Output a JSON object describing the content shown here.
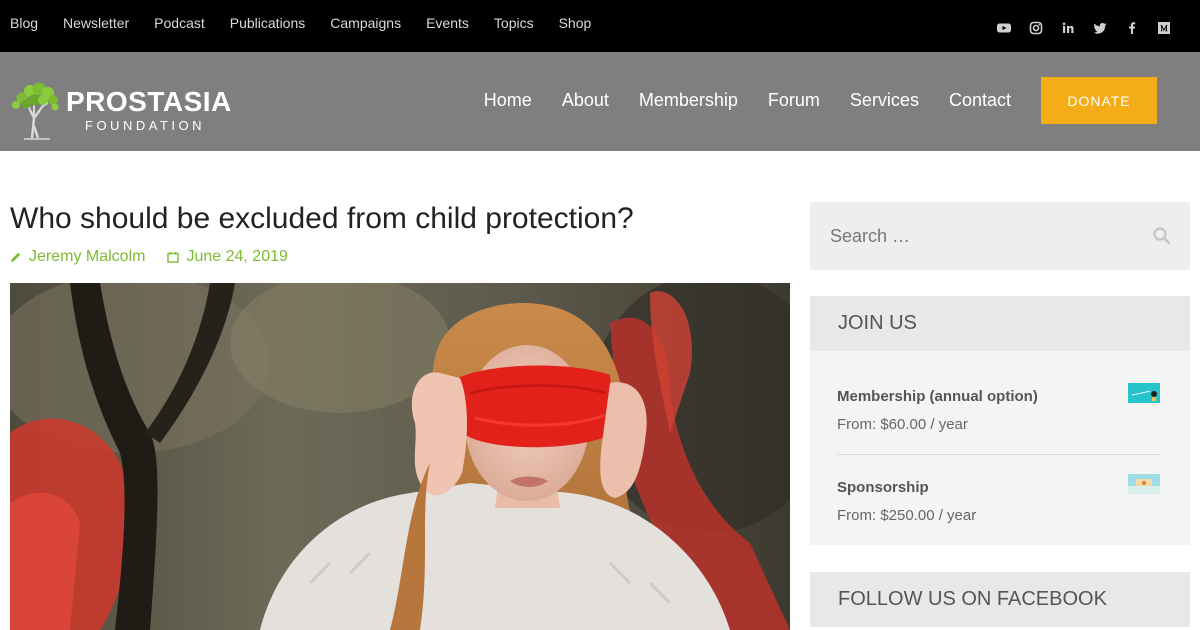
{
  "topbar": {
    "links": [
      "Blog",
      "Newsletter",
      "Podcast",
      "Publications",
      "Campaigns",
      "Events",
      "Topics",
      "Shop"
    ],
    "social_icons": [
      "youtube-icon",
      "instagram-icon",
      "linkedin-icon",
      "twitter-icon",
      "facebook-icon",
      "medium-icon"
    ]
  },
  "header": {
    "logo_name": "PROSTASIA",
    "logo_sub": "FOUNDATION",
    "nav": [
      "Home",
      "About",
      "Membership",
      "Forum",
      "Services",
      "Contact"
    ],
    "donate_label": "DONATE"
  },
  "article": {
    "title": "Who should be excluded from child protection?",
    "author": "Jeremy Malcolm",
    "date": "June 24, 2019"
  },
  "sidebar": {
    "search_placeholder": "Search …",
    "join_title": "JOIN US",
    "products": [
      {
        "name": "Membership (annual option)",
        "price": "From: $60.00 / year"
      },
      {
        "name": "Sponsorship",
        "price": "From: $250.00 / year"
      }
    ],
    "facebook_title": "FOLLOW US ON FACEBOOK"
  },
  "colors": {
    "topbar_bg": "#000000",
    "header_bg": "#7f7f7f",
    "accent_green": "#7dbb32",
    "donate_orange": "#f5ad17"
  }
}
